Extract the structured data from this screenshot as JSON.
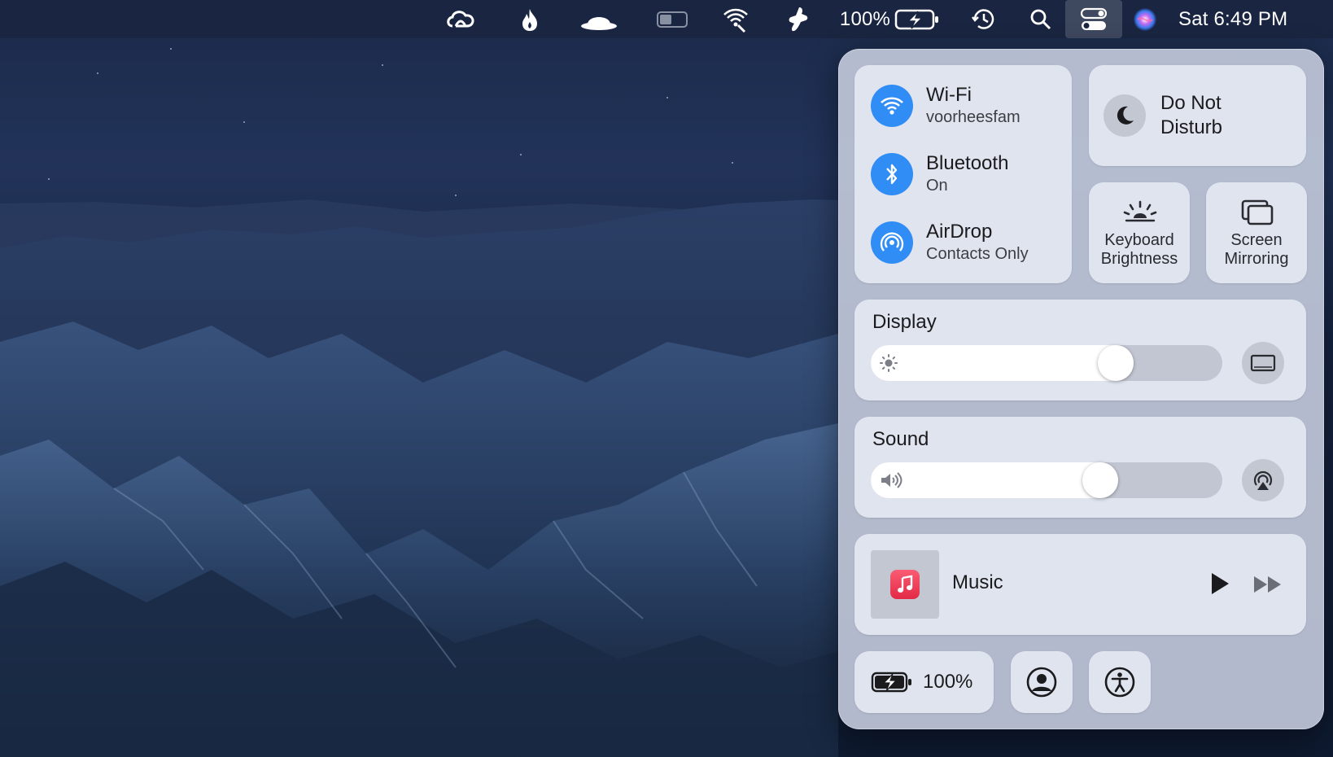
{
  "menubar": {
    "battery_percent": "100%",
    "clock": "Sat 6:49 PM",
    "icons": [
      "creative-cloud-icon",
      "flame-icon",
      "bowler-hat-icon",
      "toggle-icon",
      "wifi-icon",
      "thumb-icon",
      "battery-icon",
      "time-machine-icon",
      "search-icon",
      "control-center-icon",
      "siri-icon"
    ]
  },
  "control_center": {
    "wifi": {
      "title": "Wi-Fi",
      "status": "voorheesfam"
    },
    "bluetooth": {
      "title": "Bluetooth",
      "status": "On"
    },
    "airdrop": {
      "title": "AirDrop",
      "status": "Contacts Only"
    },
    "do_not_disturb": {
      "line1": "Do Not",
      "line2": "Disturb"
    },
    "keyboard_brightness": {
      "line1": "Keyboard",
      "line2": "Brightness"
    },
    "screen_mirroring": {
      "line1": "Screen",
      "line2": "Mirroring"
    },
    "display": {
      "title": "Display",
      "level": 0.72
    },
    "sound": {
      "title": "Sound",
      "level": 0.67
    },
    "music": {
      "title": "Music"
    },
    "battery": {
      "label": "100%"
    },
    "colors": {
      "accent": "#2f8df5",
      "music": "#e22a45"
    }
  }
}
